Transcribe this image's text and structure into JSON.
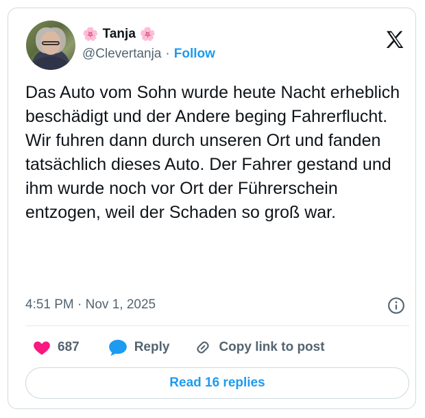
{
  "author": {
    "display_name": "Tanja",
    "name_emoji": "🌸",
    "handle": "@Clevertanja",
    "separator": "·",
    "follow_label": "Follow"
  },
  "tweet": {
    "text": "Das Auto vom Sohn wurde heute Nacht erheblich beschädigt und der Andere beging Fahrerflucht. Wir fuhren dann durch unseren Ort und fanden tatsächlich dieses Auto. Der Fahrer gestand und ihm wurde noch vor Ort der Führerschein entzogen, weil der Schaden so groß war.",
    "timestamp": "4:51 PM · Nov 1, 2025"
  },
  "actions": {
    "like_count": "687",
    "reply_label": "Reply",
    "copy_link_label": "Copy link to post"
  },
  "read_replies_label": "Read 16 replies",
  "colors": {
    "accent": "#1d9bf0",
    "heart": "#f91880",
    "muted_text": "#536471",
    "border": "#cfd9de"
  },
  "icons": [
    "x-logo-icon",
    "info-icon",
    "heart-icon",
    "reply-bubble-icon",
    "link-icon",
    "flower-icon"
  ]
}
